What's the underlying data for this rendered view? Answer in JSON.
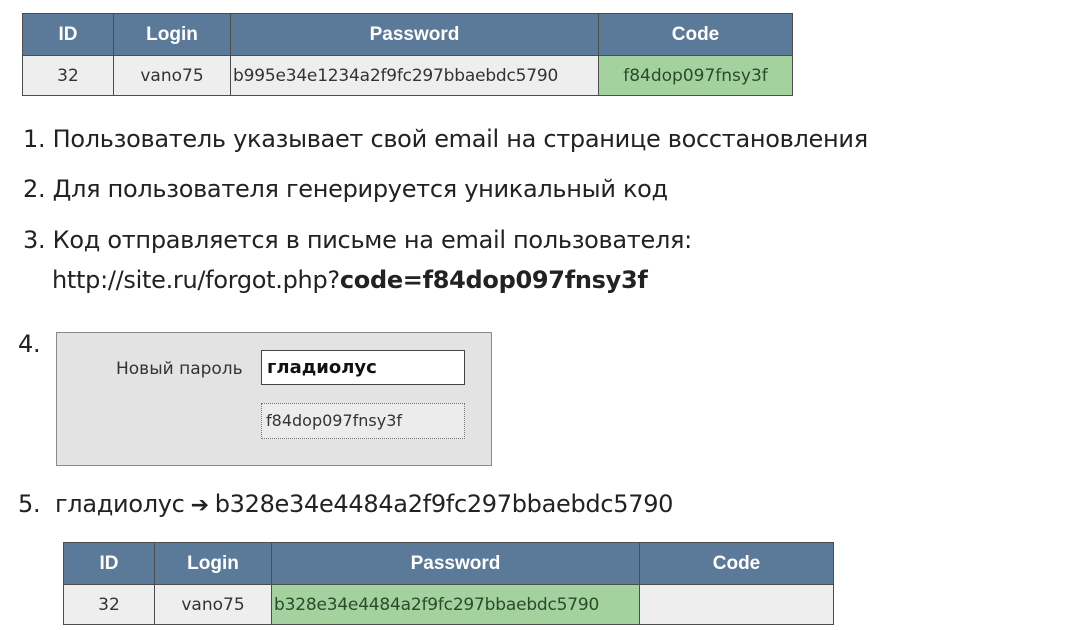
{
  "table_before": {
    "headers": [
      "ID",
      "Login",
      "Password",
      "Code"
    ],
    "row": [
      "32",
      "vano75",
      "b995e34e1234a2f9fc297bbaebdc5790",
      "f84dop097fnsy3f"
    ]
  },
  "steps": {
    "step1": "1. Пользователь указывает свой email на странице восстановления",
    "step2": "2. Для пользователя генерируется уникальный код",
    "step3": "3. Код отправляется в письме на email пользователя:",
    "step3_url_prefix": "http://site.ru/forgot.php?",
    "step3_url_param": "code=f84dop097fnsy3f",
    "step4_number": "4.",
    "step5_number": "5.",
    "step5_input": "гладиолус",
    "step5_arrow": "➔",
    "step5_hash": "b328e34e4484a2f9fc297bbaebdc5790"
  },
  "form": {
    "label": "Новый пароль",
    "password_value": "гладиолус",
    "code_value": "f84dop097fnsy3f"
  },
  "table_after": {
    "headers": [
      "ID",
      "Login",
      "Password",
      "Code"
    ],
    "row": [
      "32",
      "vano75",
      "b328e34e4484a2f9fc297bbaebdc5790",
      ""
    ]
  },
  "colors": {
    "header_bg": "#5b7a99",
    "cell_bg": "#eeeeee",
    "highlight_bg": "#a4d29f",
    "panel_bg": "#e3e3e3"
  }
}
